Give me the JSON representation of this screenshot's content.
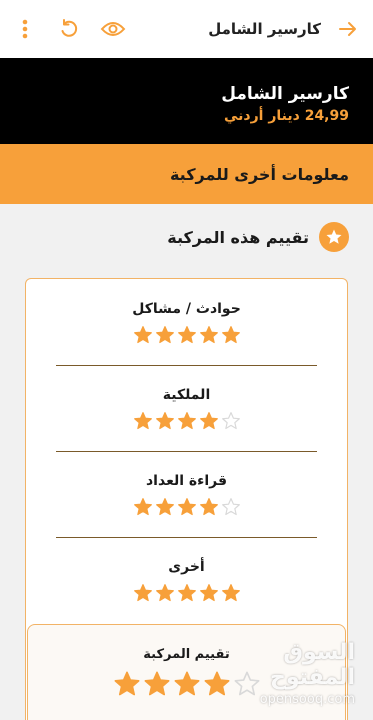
{
  "header": {
    "title": "كارسير الشامل",
    "back_icon": "arrow-right-icon",
    "icons": [
      "more-vertical-icon",
      "refresh-icon",
      "eye-icon"
    ]
  },
  "product": {
    "name": "كارسير الشامل",
    "price": "24,99 دينار أردني"
  },
  "section": {
    "title": "معلومات أخرى للمركبة"
  },
  "rating": {
    "title": "تقييم هذه المركبة",
    "items": [
      {
        "label": "حوادث / مشاكل",
        "stars": 5
      },
      {
        "label": "الملكية",
        "stars": 4
      },
      {
        "label": "قراءة العداد",
        "stars": 4
      },
      {
        "label": "أخرى",
        "stars": 5
      }
    ],
    "overall": {
      "label": "تقييم المركبة",
      "stars": 4
    }
  },
  "watermark": {
    "arabic": "السوق المفتوح",
    "latin": "opensooq.com"
  },
  "colors": {
    "accent": "#f7a03a",
    "star_empty": "#d9d9d9"
  }
}
